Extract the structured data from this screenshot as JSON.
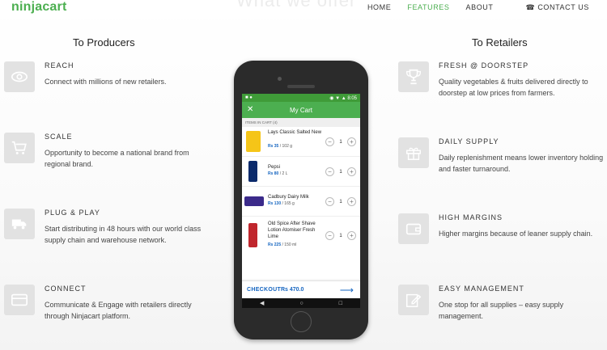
{
  "header": {
    "logo": "ninjacart",
    "ghost_title": "What we offer",
    "menu": [
      "HOME",
      "FEATURES",
      "ABOUT",
      "CONTACT US"
    ],
    "active_menu": "FEATURES"
  },
  "producers": {
    "title": "To Producers",
    "features": [
      {
        "title": "REACH",
        "desc": "Connect with millions of new retailers.",
        "icon": "eye-icon"
      },
      {
        "title": "SCALE",
        "desc": "Opportunity to become a national brand from regional brand.",
        "icon": "cart-icon"
      },
      {
        "title": "PLUG & PLAY",
        "desc": "Start distributing in 48 hours with our world class supply chain and warehouse network.",
        "icon": "truck-icon"
      },
      {
        "title": "CONNECT",
        "desc": "Communicate & Engage with retailers directly through Ninjacart platform.",
        "icon": "card-icon"
      }
    ]
  },
  "retailers": {
    "title": "To Retailers",
    "features": [
      {
        "title": "FRESH @ DOORSTEP",
        "desc": "Quality vegetables & fruits delivered directly to doorstep at low prices from farmers.",
        "icon": "trophy-icon"
      },
      {
        "title": "DAILY SUPPLY",
        "desc": "Daily replenishment means lower inventory holding and faster turnaround.",
        "icon": "gift-icon"
      },
      {
        "title": "HIGH MARGINS",
        "desc": "Higher margins because of leaner supply chain.",
        "icon": "wallet-icon"
      },
      {
        "title": "EASY MANAGEMENT",
        "desc": "One stop for all supplies – easy supply management.",
        "icon": "edit-icon"
      }
    ]
  },
  "phone": {
    "status_time": "8:05",
    "app_title": "My Cart",
    "items_header": "ITEMS IN CART (4)",
    "items": [
      {
        "name": "Lays Classic Salted New",
        "price": "Rs 35",
        "unit": "/ 102 g",
        "qty": "1",
        "color": "#f5c518"
      },
      {
        "name": "Pepsi",
        "price": "Rs 80",
        "unit": "/ 2 L",
        "qty": "1",
        "color": "#0b2a6b"
      },
      {
        "name": "Cadbury Dairy Milk",
        "price": "Rs 130",
        "unit": "/ 165 g",
        "qty": "1",
        "color": "#3b2a8a"
      },
      {
        "name": "Old Spice After Shave Lotion Atomiser Fresh Lime",
        "price": "Rs 225",
        "unit": "/ 150 ml",
        "qty": "1",
        "color": "#c0262d"
      }
    ],
    "checkout_label": "CHECKOUT",
    "checkout_amount": "Rs 470.0"
  },
  "colors": {
    "accent": "#4caf50",
    "link_blue": "#1565c0",
    "icon_box": "#e2e2e2"
  }
}
